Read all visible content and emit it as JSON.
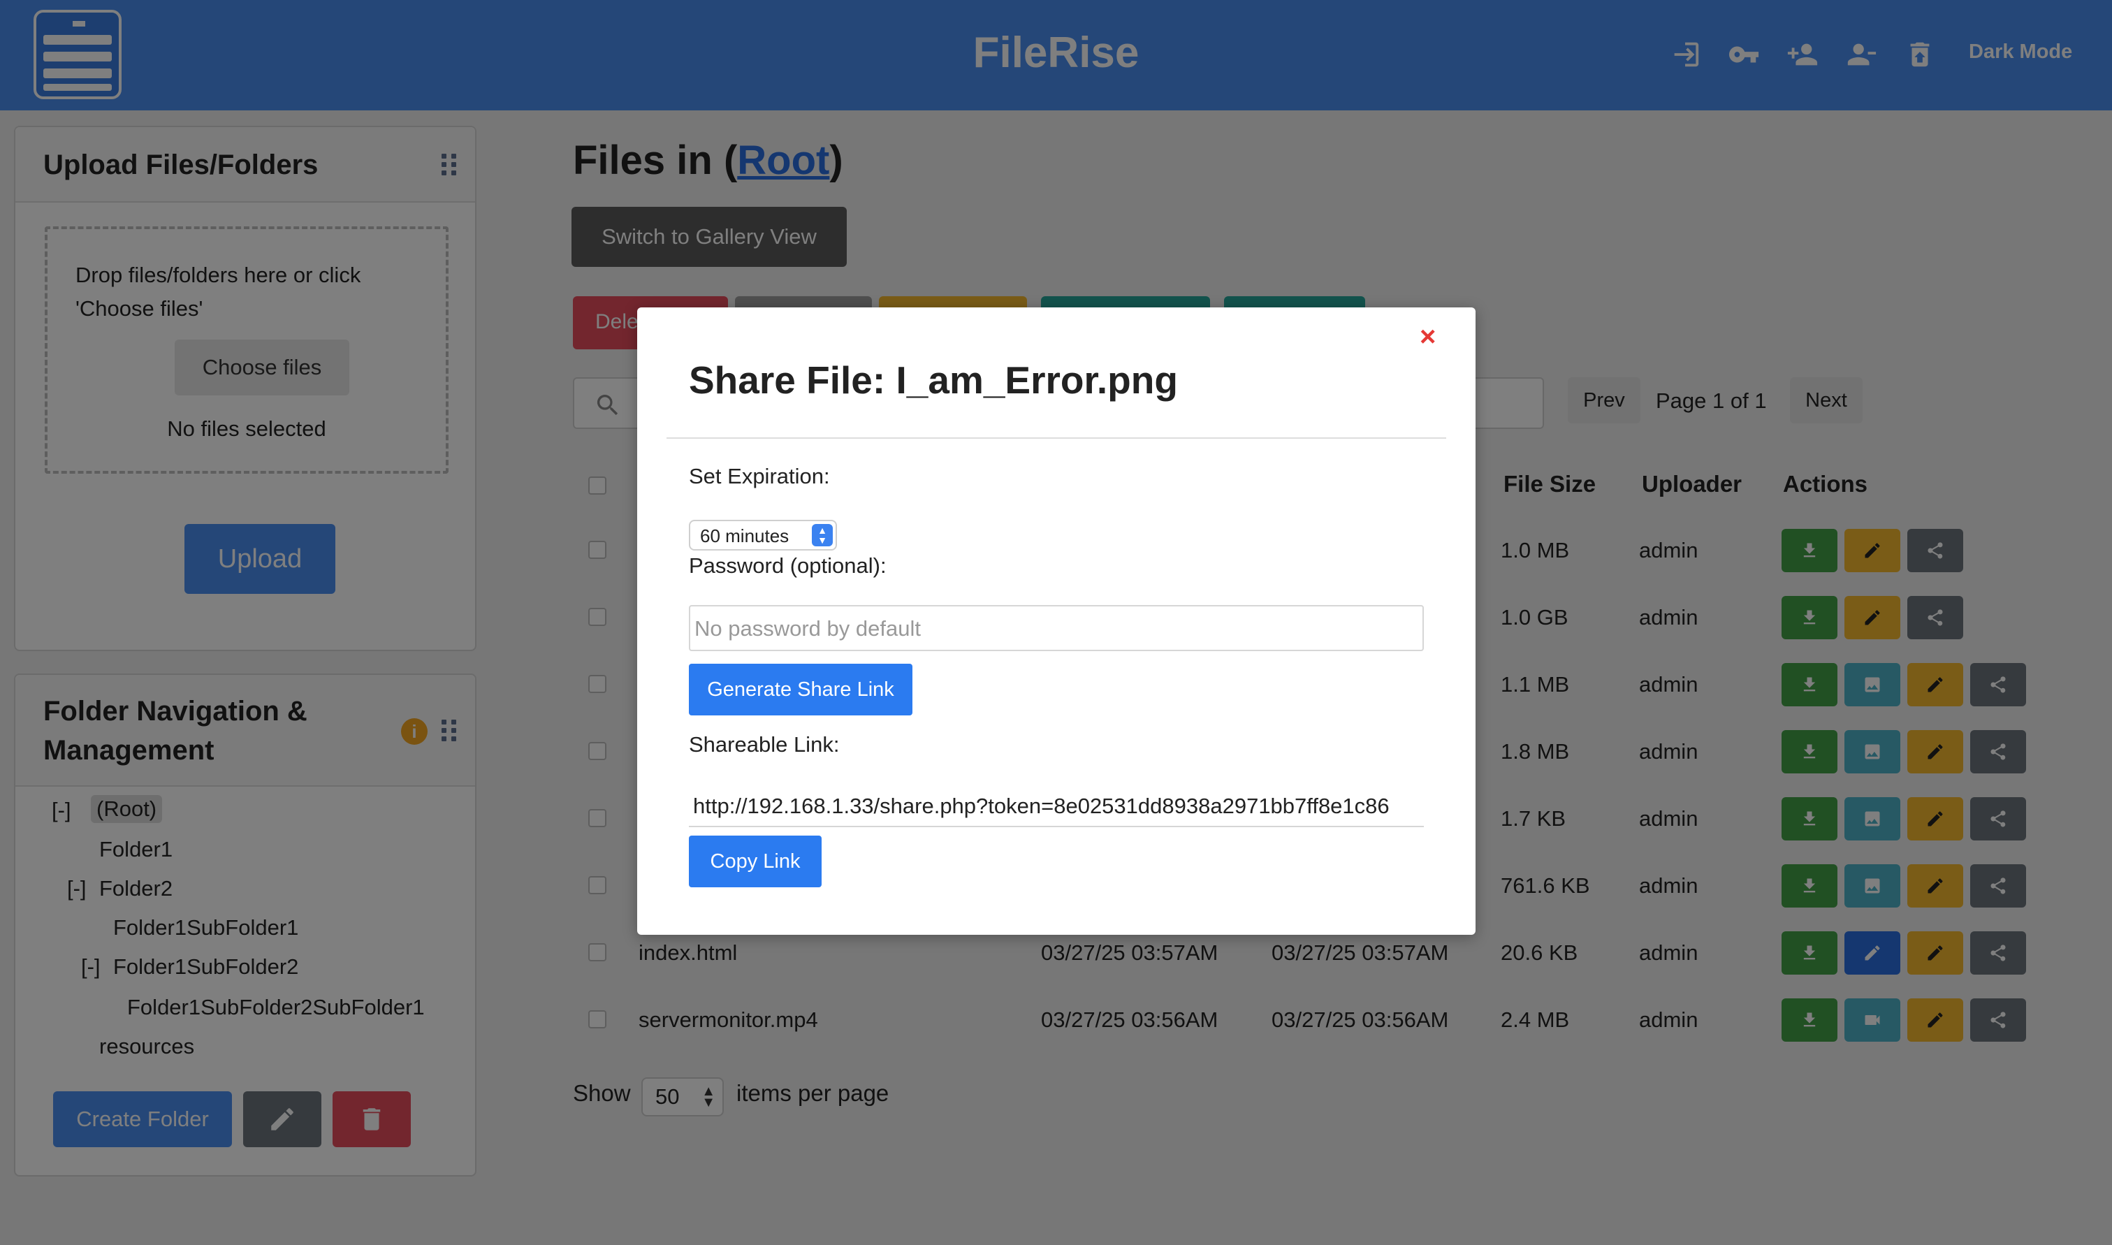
{
  "header": {
    "title": "FileRise",
    "dark_mode_label": "Dark Mode",
    "icons": [
      "logout-icon",
      "key-icon",
      "add-user-icon",
      "remove-user-icon",
      "trash-restore-icon"
    ]
  },
  "upload_panel": {
    "title": "Upload Files/Folders",
    "drop_text": "Drop files/folders here or click 'Choose files'",
    "choose_label": "Choose files",
    "no_files": "No files selected",
    "upload_label": "Upload"
  },
  "folder_panel": {
    "title_line1": "Folder Navigation &",
    "title_line2": "Management",
    "info_badge": "i",
    "tree": [
      {
        "toggle": "[-]",
        "label": "(Root)"
      },
      {
        "toggle": "",
        "label": "Folder1"
      },
      {
        "toggle": "[-]",
        "label": "Folder2"
      },
      {
        "toggle": "",
        "label": "Folder1SubFolder1"
      },
      {
        "toggle": "[-]",
        "label": "Folder1SubFolder2"
      },
      {
        "toggle": "",
        "label": "Folder1SubFolder2SubFolder1"
      },
      {
        "toggle": "",
        "label": "resources"
      }
    ],
    "create_label": "Create Folder"
  },
  "main": {
    "title_prefix": "Files in (",
    "title_link": "Root",
    "title_suffix": ")",
    "gallery_label": "Switch to Gallery View",
    "delete_partial": "Dele",
    "pagination": {
      "prev": "Prev",
      "info": "Page 1 of 1",
      "next": "Next"
    },
    "columns": {
      "size": "File Size",
      "uploader": "Uploader",
      "actions": "Actions"
    },
    "rows": [
      {
        "name": "",
        "uploaded": "",
        "modified": "",
        "size": "1.0 MB",
        "uploader": "admin"
      },
      {
        "name": "",
        "uploaded": "",
        "modified": "",
        "size": "1.0 GB",
        "uploader": "admin"
      },
      {
        "name": "",
        "uploaded": "",
        "modified": "",
        "size": "1.1 MB",
        "uploader": "admin"
      },
      {
        "name": "",
        "uploaded": "",
        "modified": "",
        "size": "1.8 MB",
        "uploader": "admin"
      },
      {
        "name": "",
        "uploaded": "",
        "modified": "",
        "size": "1.7 KB",
        "uploader": "admin"
      },
      {
        "name": "",
        "uploaded": "",
        "modified": "",
        "size": "761.6 KB",
        "uploader": "admin"
      },
      {
        "name": "index.html",
        "uploaded": "03/27/25 03:57AM",
        "modified": "03/27/25 03:57AM",
        "size": "20.6 KB",
        "uploader": "admin"
      },
      {
        "name": "servermonitor.mp4",
        "uploaded": "03/27/25 03:56AM",
        "modified": "03/27/25 03:56AM",
        "size": "2.4 MB",
        "uploader": "admin"
      }
    ],
    "show_label": "Show",
    "per_page": "50",
    "items_label": "items per page"
  },
  "share_modal": {
    "close": "×",
    "title": "Share File: I_am_Error.png",
    "expiration_label": "Set Expiration:",
    "expiration_value": "60 minutes",
    "password_label": "Password (optional):",
    "password_placeholder": "No password by default",
    "generate_label": "Generate Share Link",
    "link_label": "Shareable Link:",
    "link_value": "http://192.168.1.33/share.php?token=8e02531dd8938a2971bb7ff8e1c86",
    "copy_label": "Copy Link"
  },
  "colors": {
    "header": "#4a8ef0",
    "primary": "#2b7bf0",
    "download": "#43a047",
    "preview": "#4fb3c8",
    "edit": "#f5b82e",
    "share": "#6c757d",
    "danger": "#e74c5c"
  }
}
